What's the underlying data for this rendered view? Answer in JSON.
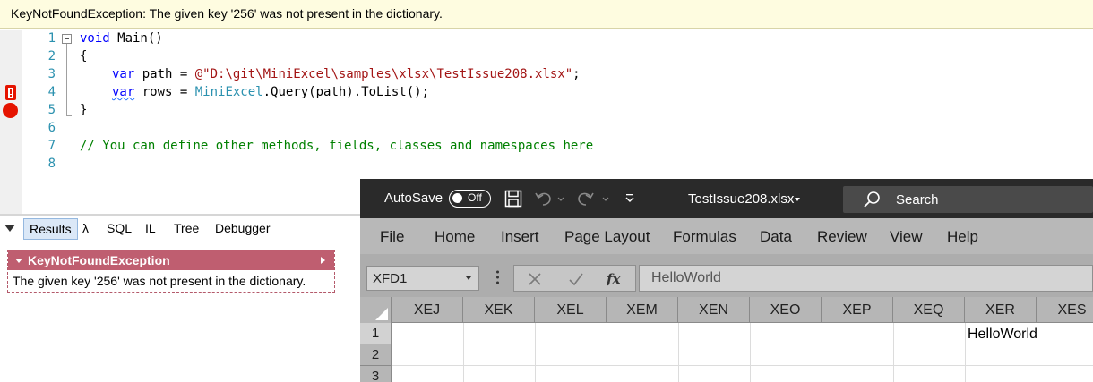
{
  "banner": {
    "message": "KeyNotFoundException: The given key '256' was not present in the dictionary."
  },
  "editor": {
    "line_numbers": [
      "1",
      "2",
      "3",
      "4",
      "5",
      "6",
      "7",
      "8"
    ],
    "code": {
      "l1_kw": "void",
      "l1_rest": " Main()",
      "l2": "{",
      "l3_kw": "var",
      "l3_mid": " path = ",
      "l3_str": "@\"D:\\git\\MiniExcel\\samples\\xlsx\\TestIssue208.xlsx\"",
      "l3_end": ";",
      "l4_kw": "var",
      "l4_mid": " rows = ",
      "l4_cls": "MiniExcel",
      "l4_end": ".Query(path).ToList();",
      "l5": "}",
      "l7": "// You can define other methods, fields, classes and namespaces here"
    }
  },
  "results": {
    "tabs": [
      "Results",
      "λ",
      "SQL",
      "IL",
      "Tree",
      "Debugger"
    ],
    "active_tab": "Results",
    "exception_title": "KeyNotFoundException",
    "exception_message": "The given key '256' was not present in the dictionary."
  },
  "excel": {
    "autosave_label": "AutoSave",
    "autosave_state": "Off",
    "doc_title": "TestIssue208.xlsx",
    "search_placeholder": "Search",
    "menu": [
      "File",
      "Home",
      "Insert",
      "Page Layout",
      "Formulas",
      "Data",
      "Review",
      "View",
      "Help"
    ],
    "name_box": "XFD1",
    "formula_value": "HelloWorld",
    "columns": [
      "XEJ",
      "XEK",
      "XEL",
      "XEM",
      "XEN",
      "XEO",
      "XEP",
      "XEQ",
      "XER",
      "XES"
    ],
    "rows": [
      "1",
      "2",
      "3"
    ],
    "cells": {
      "XER1": "HelloWorld"
    }
  },
  "colors": {
    "keyword": "#0000ff",
    "string": "#a31515",
    "type": "#2b91af",
    "comment": "#008000",
    "breakpoint": "#e51400",
    "exception_header": "#bf5e70",
    "banner_bg": "#fefce0"
  },
  "icons": [
    "collapse-icon",
    "breakpoint-icon",
    "exception-marker-icon",
    "save-icon",
    "undo-icon",
    "redo-icon",
    "customize-qat-icon",
    "search-icon",
    "cancel-icon",
    "enter-icon",
    "fx-icon"
  ]
}
